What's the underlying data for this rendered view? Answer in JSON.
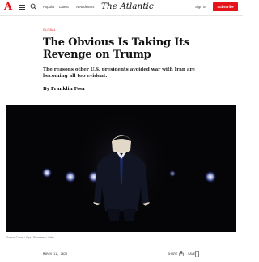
{
  "header": {
    "logo_letter": "A",
    "nav": {
      "popular": "Popular",
      "latest": "Latest",
      "newsletters": "Newsletters"
    },
    "brand": "The Atlantic",
    "sign_in": "Sign In",
    "subscribe": "Subscribe"
  },
  "article": {
    "section": "GLOBAL",
    "headline": "The Obvious Is Taking Its Revenge on Trump",
    "dek": "The reasons other U.S. presidents avoided war with Iran are becoming all too evident.",
    "byline": "By Franklin Foer",
    "caption": "Samuel Corum / Sipa / Bloomberg / Getty",
    "date": "MARCH 11, 2026",
    "share": "SHARE",
    "save": "SAVE"
  },
  "colors": {
    "accent": "#e7131a",
    "hero_background": "#050507"
  },
  "icons": [
    "menu-icon",
    "search-icon",
    "share-icon",
    "bookmark-icon"
  ]
}
